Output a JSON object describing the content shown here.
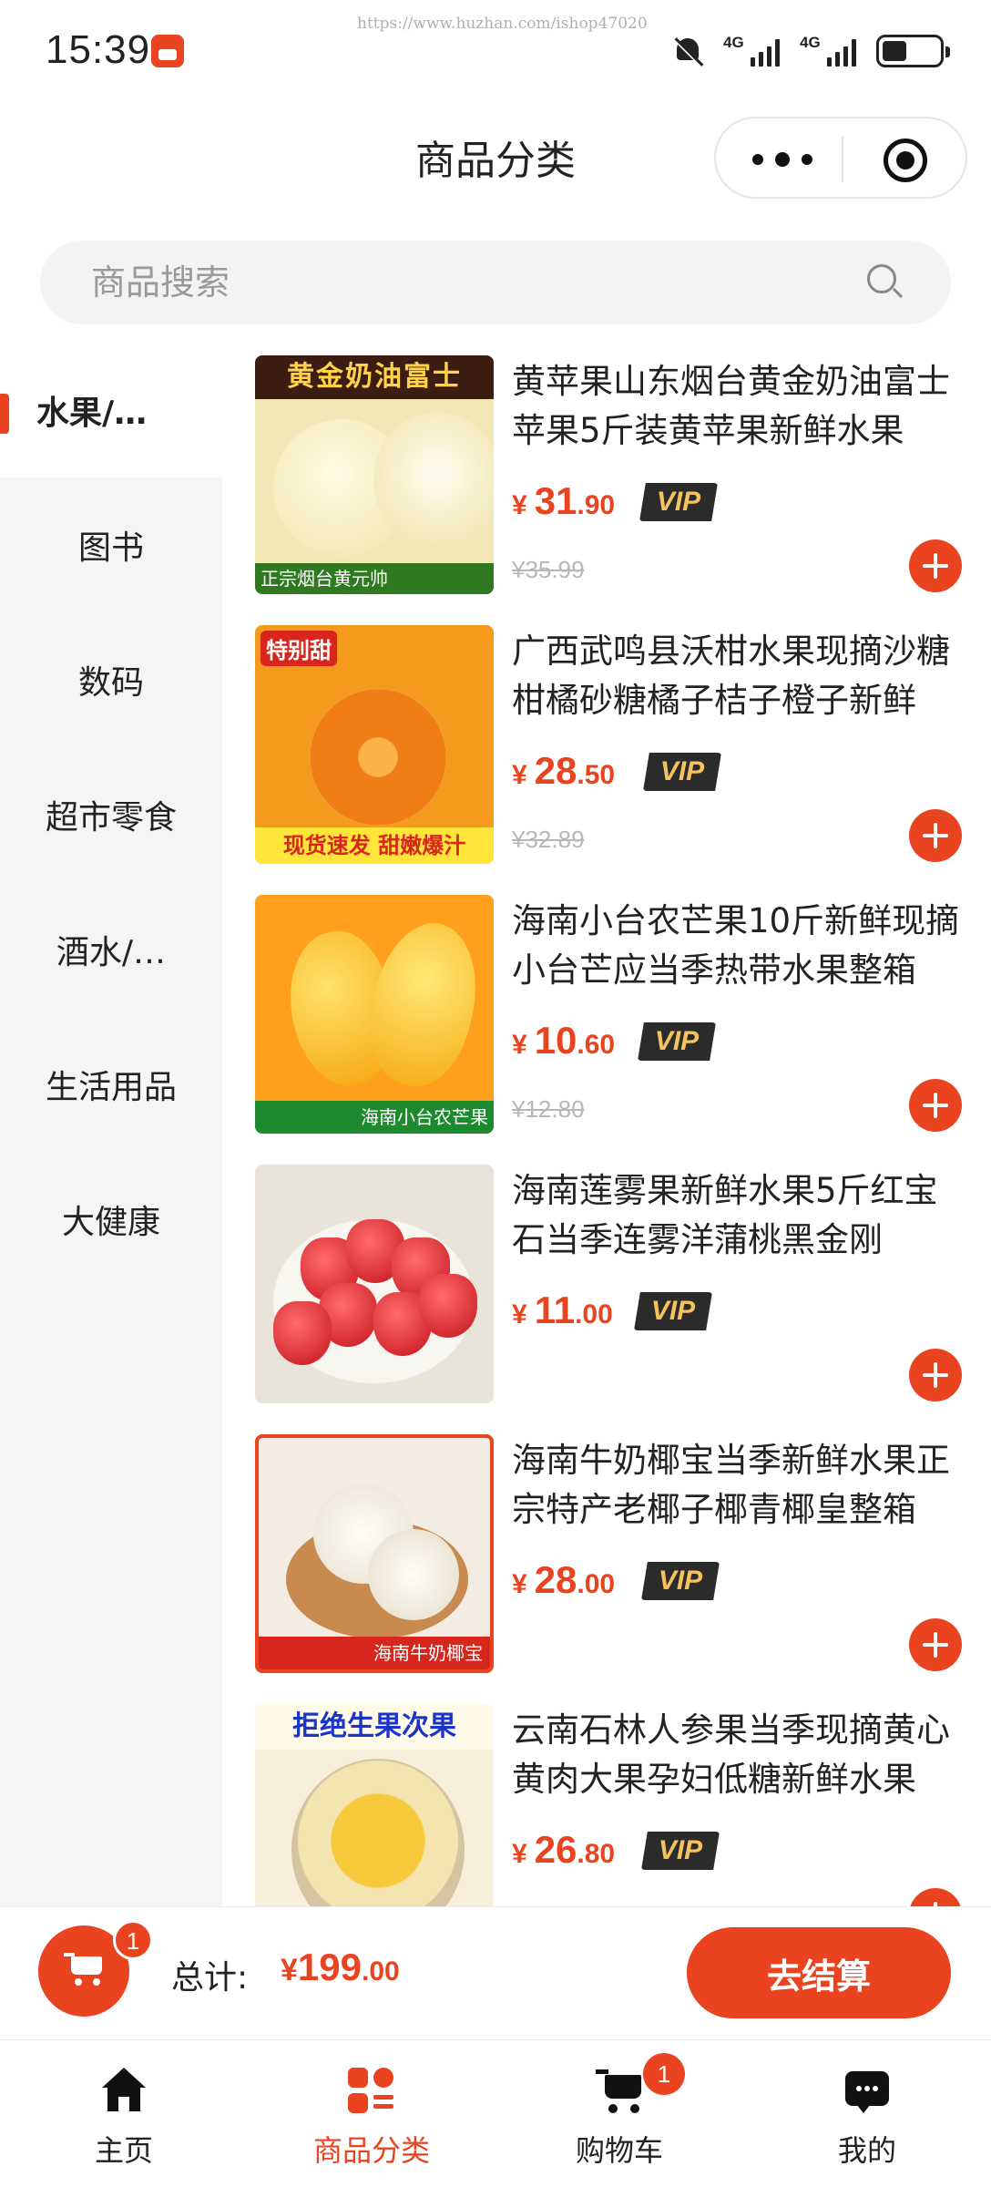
{
  "status_bar": {
    "time": "15:39",
    "url": "https://www.huzhan.com/ishop47020",
    "network_1": "4G",
    "network_2": "4G"
  },
  "header": {
    "title": "商品分类"
  },
  "search": {
    "placeholder": "商品搜索"
  },
  "sidebar": {
    "items": [
      {
        "label": "水果/…",
        "active": true
      },
      {
        "label": "图书"
      },
      {
        "label": "数码"
      },
      {
        "label": "超市零食"
      },
      {
        "label": "酒水/…"
      },
      {
        "label": "生活用品"
      },
      {
        "label": "大健康"
      }
    ]
  },
  "products": [
    {
      "title": "黄苹果山东烟台黄金奶油富士苹果5斤装黄苹果新鲜水果",
      "currency": "¥",
      "price_int": "31",
      "price_dec": ".90",
      "vip": "VIP",
      "old_price": "¥35.99",
      "image_caption": "黄金奶油富士",
      "image_footer": "正宗烟台黄元帅"
    },
    {
      "title": "广西武鸣县沃柑水果现摘沙糖柑橘砂糖橘子桔子橙子新鲜",
      "currency": "¥",
      "price_int": "28",
      "price_dec": ".50",
      "vip": "VIP",
      "old_price": "¥32.89",
      "image_caption": "特别甜",
      "image_footer": "现货速发 甜嫩爆汁"
    },
    {
      "title": "海南小台农芒果10斤新鲜现摘小台芒应当季热带水果整箱",
      "currency": "¥",
      "price_int": "10",
      "price_dec": ".60",
      "vip": "VIP",
      "old_price": "¥12.80",
      "image_footer": "海南小台农芒果"
    },
    {
      "title": "海南莲雾果新鲜水果5斤红宝石当季连雾洋蒲桃黑金刚",
      "currency": "¥",
      "price_int": "11",
      "price_dec": ".00",
      "vip": "VIP",
      "old_price": ""
    },
    {
      "title": "海南牛奶椰宝当季新鲜水果正宗特产老椰子椰青椰皇整箱",
      "currency": "¥",
      "price_int": "28",
      "price_dec": ".00",
      "vip": "VIP",
      "old_price": "",
      "image_footer": "海南牛奶椰宝"
    },
    {
      "title": "云南石林人参果当季现摘黄心黄肉大果孕妇低糖新鲜水果",
      "currency": "¥",
      "price_int": "26",
      "price_dec": ".80",
      "vip": "VIP",
      "old_price": "",
      "image_caption": "拒绝生果次果"
    }
  ],
  "cart_bar": {
    "badge": "1",
    "total_label": "总计:",
    "total_symbol": "¥",
    "total_int": "199",
    "total_dec": ".00",
    "checkout_label": "去结算"
  },
  "tab_bar": {
    "tabs": [
      {
        "label": "主页",
        "icon": "home-icon"
      },
      {
        "label": "商品分类",
        "icon": "category-icon",
        "active": true
      },
      {
        "label": "购物车",
        "icon": "cart-icon",
        "badge": "1"
      },
      {
        "label": "我的",
        "icon": "chat-icon"
      }
    ]
  },
  "colors": {
    "accent": "#e9431f",
    "vip_bg": "#2b2b2b",
    "vip_text": "#f6c35e",
    "sidebar_bg": "#f5f5f5"
  }
}
